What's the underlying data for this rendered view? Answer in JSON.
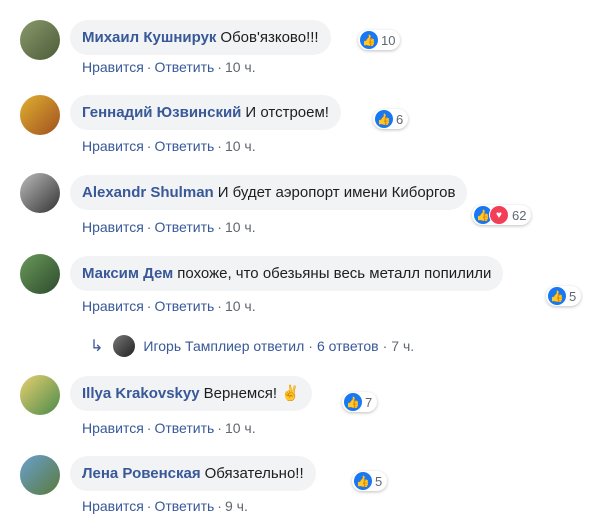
{
  "comments": [
    {
      "author": "Михаил Кушнирук",
      "text": "Обов'язково!!!",
      "reactions": "10",
      "like": "Нравится",
      "reply": "Ответить",
      "time": "10 ч."
    },
    {
      "author": "Геннадий Юзвинский",
      "text": "И отстроем!",
      "reactions": "6",
      "like": "Нравится",
      "reply": "Ответить",
      "time": "10 ч."
    },
    {
      "author": "Alexandr Shulman",
      "text": "И будет аэропорт имени Киборгов",
      "reactions": "62",
      "like": "Нравится",
      "reply": "Ответить",
      "time": "10 ч."
    },
    {
      "author": "Максим Дем",
      "text": "похоже, что обезьяны весь металл попилили",
      "reactions": "5",
      "like": "Нравится",
      "reply": "Ответить",
      "time": "10 ч."
    },
    {
      "author": "Illya Krakovskyy",
      "text": "Вернемся! ✌",
      "reactions": "7",
      "like": "Нравится",
      "reply": "Ответить",
      "time": "10 ч."
    },
    {
      "author": "Лена Ровенская",
      "text": "Обязательно!!",
      "reactions": "5",
      "like": "Нравится",
      "reply": "Ответить",
      "time": "9 ч."
    }
  ],
  "replies": {
    "author": "Игорь Тамплиер",
    "verb": "ответил",
    "count": "6 ответов",
    "time": "7 ч."
  },
  "colors": {
    "link": "#385898",
    "bubble": "#f2f3f5",
    "like": "#1877f2",
    "love": "#f33e58"
  }
}
